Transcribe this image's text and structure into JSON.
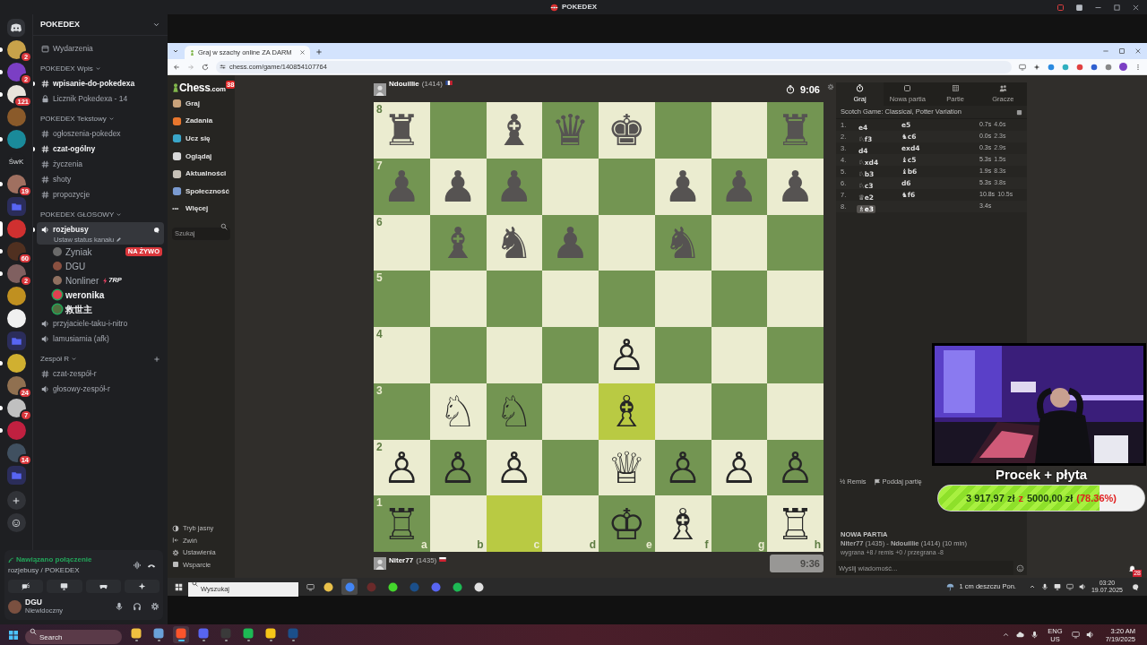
{
  "title_bar": {
    "title": "POKEDEX"
  },
  "discord": {
    "server_name": "POKEDEX",
    "servers": [
      {
        "kind": "home",
        "unread": false,
        "selected": false
      },
      {
        "kind": "server",
        "color": "#c8a24a",
        "badge": "2",
        "unread": true,
        "selected": false
      },
      {
        "kind": "server",
        "color": "#7b3fc4",
        "badge": "2",
        "unread": true,
        "selected": false
      },
      {
        "kind": "server",
        "color": "#e8e4dc",
        "badge": "121",
        "unread": true,
        "selected": false
      },
      {
        "kind": "server",
        "color": "#8a5a2a",
        "unread": false,
        "selected": false
      },
      {
        "kind": "server",
        "color": "#1a8a9a",
        "unread": true,
        "selected": false
      },
      {
        "kind": "text",
        "label": "ŚwK",
        "unread": false,
        "selected": false
      },
      {
        "kind": "server",
        "color": "#a07060",
        "badge": "19",
        "unread": true,
        "selected": false
      },
      {
        "kind": "folder",
        "unread": false,
        "selected": false
      },
      {
        "kind": "server",
        "color": "#d03030",
        "unread": false,
        "selected": true
      },
      {
        "kind": "server",
        "color": "#503020",
        "badge": "60",
        "unread": true,
        "selected": false
      },
      {
        "kind": "server",
        "color": "#806060",
        "badge": "2",
        "unread": true,
        "selected": false
      },
      {
        "kind": "server",
        "color": "#c09020",
        "unread": false,
        "selected": false
      },
      {
        "kind": "server",
        "color": "#f0f0f0",
        "unread": false,
        "selected": false
      },
      {
        "kind": "folder",
        "unread": false,
        "selected": false
      },
      {
        "kind": "server",
        "color": "#d0b030",
        "unread": true,
        "selected": false
      },
      {
        "kind": "server",
        "color": "#907050",
        "badge": "24",
        "unread": false,
        "selected": false
      },
      {
        "kind": "server",
        "color": "#c0c0c0",
        "badge": "7",
        "unread": true,
        "selected": false
      },
      {
        "kind": "server",
        "color": "#c02040",
        "unread": true,
        "selected": false
      },
      {
        "kind": "server",
        "color": "#405060",
        "badge": "14",
        "unread": false,
        "selected": false
      },
      {
        "kind": "folder",
        "unread": false,
        "selected": false
      }
    ],
    "channels": [
      {
        "kind": "events",
        "label": "Wydarzenia"
      },
      {
        "kind": "category",
        "label": "POKEDEX Wpis",
        "add_button": false
      },
      {
        "kind": "text",
        "label": "wpisanie-do-pokedexa",
        "unread": true,
        "selected": false
      },
      {
        "kind": "locked",
        "label": "Licznik Pokedexa - 14",
        "unread": false,
        "selected": false
      },
      {
        "kind": "category",
        "label": "POKEDEX Tekstowy",
        "add_button": false
      },
      {
        "kind": "text",
        "label": "ogłoszenia-pokedex",
        "unread": false,
        "selected": false
      },
      {
        "kind": "text",
        "label": "czat-ogólny",
        "unread": true,
        "selected": false
      },
      {
        "kind": "text",
        "label": "życzenia",
        "unread": false,
        "selected": false
      },
      {
        "kind": "text",
        "label": "shoty",
        "unread": false,
        "selected": false
      },
      {
        "kind": "text",
        "label": "propozycje",
        "unread": false,
        "selected": false
      },
      {
        "kind": "category",
        "label": "POKEDEX GŁOSOWY",
        "add_button": false
      },
      {
        "kind": "voice",
        "label": "rozjebusy",
        "unread": true,
        "selected": true,
        "status": "Ustaw status kanału",
        "members": [
          {
            "name": "Zyniak",
            "color": "#6a6a6a",
            "speaking": false,
            "badge": "NA ŻYWO"
          },
          {
            "name": "DGU",
            "color": "#8a5040",
            "speaking": false
          },
          {
            "name": "Nonliner",
            "color": "#907060",
            "speaking": false,
            "tag": "7RP"
          },
          {
            "name": "weronika",
            "color": "#e04050",
            "speaking": true
          },
          {
            "name": "救世主",
            "color": "#507040",
            "speaking": true
          }
        ]
      },
      {
        "kind": "voice",
        "label": "przyjaciele-taku-i-nitro",
        "unread": false,
        "selected": false
      },
      {
        "kind": "voice",
        "label": "lamusiarnia (afk)",
        "unread": false,
        "selected": false
      },
      {
        "kind": "category",
        "label": "Zespół R",
        "add_button": true
      },
      {
        "kind": "text",
        "label": "czat-zespół-r",
        "unread": false,
        "selected": false
      },
      {
        "kind": "voice",
        "label": "głosowy-zespół-r",
        "unread": false,
        "selected": false
      }
    ],
    "voice_panel": {
      "status": "Nawiązano połączenie",
      "channel": "rozjebusy / POKEDEX"
    },
    "user": {
      "name": "DGU",
      "status": "Niewidoczny"
    }
  },
  "browser": {
    "tab_title": "Graj w szachy online ZA DARM",
    "url": "chess.com/game/140854107764"
  },
  "chess": {
    "logo": "Chess",
    "logo_suffix": ".com",
    "notifications": "38",
    "nav": [
      {
        "label": "Graj",
        "color": "#c9a27a"
      },
      {
        "label": "Zadania",
        "color": "#e8762d"
      },
      {
        "label": "Ucz się",
        "color": "#3aa6c9"
      },
      {
        "label": "Oglądaj",
        "color": "#d9d9d9"
      },
      {
        "label": "Aktualności",
        "color": "#c8c2b8"
      },
      {
        "label": "Społeczność",
        "color": "#7a9ad0"
      },
      {
        "label": "Więcej",
        "glyph": "•••"
      }
    ],
    "search_placeholder": "Szukaj",
    "nav_bottom": [
      {
        "label": "Tryb jasny"
      },
      {
        "label": "Zwiń"
      },
      {
        "label": "Ustawienia"
      },
      {
        "label": "Wsparcie"
      }
    ],
    "top_player": {
      "name": "Ndouillie",
      "rating": "(1414)",
      "clock": "9:06",
      "active": true
    },
    "bottom_player": {
      "name": "Niter77",
      "rating": "(1435)",
      "clock": "9:36",
      "active": false
    },
    "board": {
      "files": [
        "a",
        "b",
        "c",
        "d",
        "e",
        "f",
        "g",
        "h"
      ],
      "ranks": [
        {
          "label": "8",
          "squares": [
            {
              "piece": "♜",
              "kind": "black",
              "highlighted": false
            },
            {
              "highlighted": false
            },
            {
              "piece": "♝",
              "kind": "black",
              "highlighted": false
            },
            {
              "piece": "♛",
              "kind": "black",
              "highlighted": false
            },
            {
              "piece": "♚",
              "kind": "black",
              "highlighted": false
            },
            {
              "highlighted": false
            },
            {
              "highlighted": false
            },
            {
              "piece": "♜",
              "kind": "black",
              "highlighted": false
            }
          ]
        },
        {
          "label": "7",
          "squares": [
            {
              "piece": "♟",
              "kind": "black",
              "highlighted": false
            },
            {
              "piece": "♟",
              "kind": "black",
              "highlighted": false
            },
            {
              "piece": "♟",
              "kind": "black",
              "highlighted": false
            },
            {
              "highlighted": false
            },
            {
              "highlighted": false
            },
            {
              "piece": "♟",
              "kind": "black",
              "highlighted": false
            },
            {
              "piece": "♟",
              "kind": "black",
              "highlighted": false
            },
            {
              "piece": "♟",
              "kind": "black",
              "highlighted": false
            }
          ]
        },
        {
          "label": "6",
          "squares": [
            {
              "highlighted": false
            },
            {
              "piece": "♝",
              "kind": "black",
              "highlighted": false
            },
            {
              "piece": "♞",
              "kind": "black",
              "highlighted": false
            },
            {
              "piece": "♟",
              "kind": "black",
              "highlighted": false
            },
            {
              "highlighted": false
            },
            {
              "piece": "♞",
              "kind": "black",
              "highlighted": false
            },
            {
              "highlighted": false
            },
            {
              "highlighted": false
            }
          ]
        },
        {
          "label": "5",
          "squares": [
            {
              "highlighted": false
            },
            {
              "highlighted": false
            },
            {
              "highlighted": false
            },
            {
              "highlighted": false
            },
            {
              "highlighted": false
            },
            {
              "highlighted": false
            },
            {
              "highlighted": false
            },
            {
              "highlighted": false
            }
          ]
        },
        {
          "label": "4",
          "squares": [
            {
              "highlighted": false
            },
            {
              "highlighted": false
            },
            {
              "highlighted": false
            },
            {
              "highlighted": false
            },
            {
              "piece": "♙",
              "kind": "white",
              "highlighted": false
            },
            {
              "highlighted": false
            },
            {
              "highlighted": false
            },
            {
              "highlighted": false
            }
          ]
        },
        {
          "label": "3",
          "squares": [
            {
              "highlighted": false
            },
            {
              "piece": "♘",
              "kind": "white",
              "highlighted": false
            },
            {
              "piece": "♘",
              "kind": "white",
              "highlighted": false
            },
            {
              "highlighted": false
            },
            {
              "piece": "♗",
              "kind": "white",
              "highlighted": true
            },
            {
              "highlighted": false
            },
            {
              "highlighted": false
            },
            {
              "highlighted": false
            }
          ]
        },
        {
          "label": "2",
          "squares": [
            {
              "piece": "♙",
              "kind": "white",
              "highlighted": false
            },
            {
              "piece": "♙",
              "kind": "white",
              "highlighted": false
            },
            {
              "piece": "♙",
              "kind": "white",
              "highlighted": false
            },
            {
              "highlighted": false
            },
            {
              "piece": "♕",
              "kind": "white",
              "highlighted": false
            },
            {
              "piece": "♙",
              "kind": "white",
              "highlighted": false
            },
            {
              "piece": "♙",
              "kind": "white",
              "highlighted": false
            },
            {
              "piece": "♙",
              "kind": "white",
              "highlighted": false
            }
          ]
        },
        {
          "label": "1",
          "squares": [
            {
              "piece": "♖",
              "kind": "white",
              "highlighted": false
            },
            {
              "highlighted": false
            },
            {
              "highlighted": true
            },
            {
              "highlighted": false
            },
            {
              "piece": "♔",
              "kind": "white",
              "highlighted": false
            },
            {
              "piece": "♗",
              "kind": "white",
              "highlighted": false
            },
            {
              "highlighted": false
            },
            {
              "piece": "♖",
              "kind": "white",
              "highlighted": false
            }
          ]
        }
      ]
    },
    "panel_tabs": [
      {
        "label": "Graj",
        "selected": true
      },
      {
        "label": "Nowa partia",
        "selected": false
      },
      {
        "label": "Partie",
        "selected": false
      },
      {
        "label": "Gracze",
        "selected": false
      }
    ],
    "opening": "Scotch Game: Classical, Potter Variation",
    "moves": [
      {
        "number": "1.",
        "white": "e4",
        "black": "e5",
        "white_time": "0.7s",
        "black_time": "4.6s",
        "selected": false
      },
      {
        "number": "2.",
        "white": "♘f3",
        "black": "♞c6",
        "white_time": "0.0s",
        "black_time": "2.3s",
        "selected": false
      },
      {
        "number": "3.",
        "white": "d4",
        "black": "exd4",
        "white_time": "0.3s",
        "black_time": "2.9s",
        "selected": false
      },
      {
        "number": "4.",
        "white": "♘xd4",
        "black": "♝c5",
        "white_time": "5.3s",
        "black_time": "1.5s",
        "selected": false
      },
      {
        "number": "5.",
        "white": "♘b3",
        "black": "♝b6",
        "white_time": "1.9s",
        "black_time": "8.3s",
        "selected": false
      },
      {
        "number": "6.",
        "white": "♘c3",
        "black": "d6",
        "white_time": "5.3s",
        "black_time": "3.8s",
        "selected": false
      },
      {
        "number": "7.",
        "white": "♕e2",
        "black": "♞f6",
        "white_time": "10.8s",
        "black_time": "10.5s",
        "selected": false
      },
      {
        "number": "8.",
        "white": "♗e3",
        "white_time": "3.4s",
        "selected": true
      }
    ],
    "actions": [
      {
        "label": "½ Remis"
      },
      {
        "label": "Poddaj partię"
      }
    ],
    "game_info": {
      "heading": "NOWA PARTIA",
      "players": "**Niter77** (1435) - **Ndouillie** (1414) (10 min)",
      "result": "wygrana +8 / remis +0 / przegrana -8"
    },
    "chat_placeholder": "Wyślij wiadomość...",
    "alerts": "28"
  },
  "overlay": {
    "title": "Procek + płyta",
    "amount": "3 917,97 zł",
    "connector": "z",
    "goal": "5000,00 zł",
    "percent": "(78.36%)",
    "level": 0.7836
  },
  "stream_taskbar": {
    "search_placeholder": "Wyszukaj",
    "apps": [
      {
        "color": "#e8c04a",
        "selected": false
      },
      {
        "color": "#4285f4",
        "selected": true
      },
      {
        "color": "#6a2a2a",
        "selected": false
      },
      {
        "color": "#44d62c",
        "selected": false
      },
      {
        "color": "#1b4f8a",
        "selected": false
      },
      {
        "color": "#5865f2",
        "selected": false
      },
      {
        "color": "#1db954",
        "selected": false
      },
      {
        "color": "#e0e0e0",
        "selected": false
      }
    ],
    "weather": "1 cm deszczu Pon.",
    "time": "03:20",
    "date": "19.07.2025"
  },
  "taskbar": {
    "search_placeholder": "Search",
    "apps": [
      {
        "color": "#f0c040",
        "selected": false
      },
      {
        "color": "#6aa0d8",
        "selected": false
      },
      {
        "color": "#fb542b",
        "selected": true
      },
      {
        "color": "#5865f2",
        "selected": false
      },
      {
        "color": "#3a3a3a",
        "selected": false
      },
      {
        "color": "#1db954",
        "selected": false
      },
      {
        "color": "#f5c518",
        "selected": false
      },
      {
        "color": "#1b4f8a",
        "selected": false
      }
    ],
    "language": "ENG",
    "region": "US",
    "time": "3:20 AM",
    "date": "7/19/2025"
  }
}
